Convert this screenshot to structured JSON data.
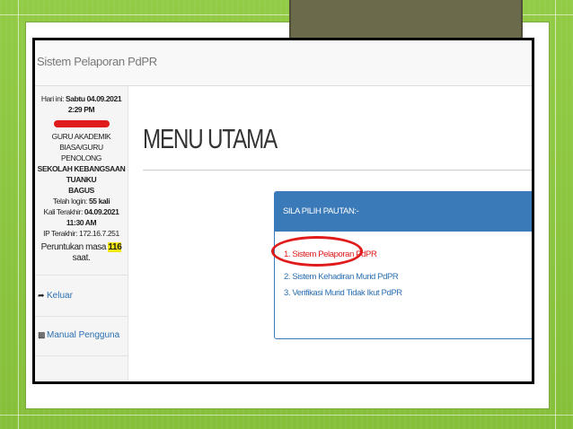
{
  "app_title": "Sistem Pelaporan PdPR",
  "sidebar": {
    "date_label": "Hari ini:",
    "date_value": "Sabtu 04.09.2021 2:29 PM",
    "role_line1": "GURU AKADEMIK BIASA/GURU",
    "role_line2": "PENOLONG",
    "school_line1": "SEKOLAH KEBANGSAAN TUANKU",
    "school_line2": "BAGUS",
    "login_count_label": "Telah login:",
    "login_count_value": "55 kali",
    "last_login_label": "Kali Terakhir:",
    "last_login_value": "04.09.2021 11:30 AM",
    "ip_label": "IP Terakhir:",
    "ip_value": "172.16.7.251",
    "session_prefix": "Peruntukan masa",
    "session_value": "116",
    "session_suffix": "saat.",
    "logout_label": "Keluar",
    "manual_label": "Manual Pengguna"
  },
  "main": {
    "title": "MENU UTAMA",
    "panel_heading": "SILA PILIH PAUTAN:-",
    "links": [
      "1. Sistem Pelaporan PdPR",
      "2. Sistem Kehadiran Murid PdPR",
      "3. Verifikasi Murid Tidak Ikut PdPR"
    ]
  },
  "colors": {
    "slide_green": "#8dc63f",
    "panel_blue": "#3a7ab8",
    "link_blue": "#2a6fb0",
    "annotation_red": "#e01b1b",
    "highlight_yellow": "#f4e70f"
  }
}
